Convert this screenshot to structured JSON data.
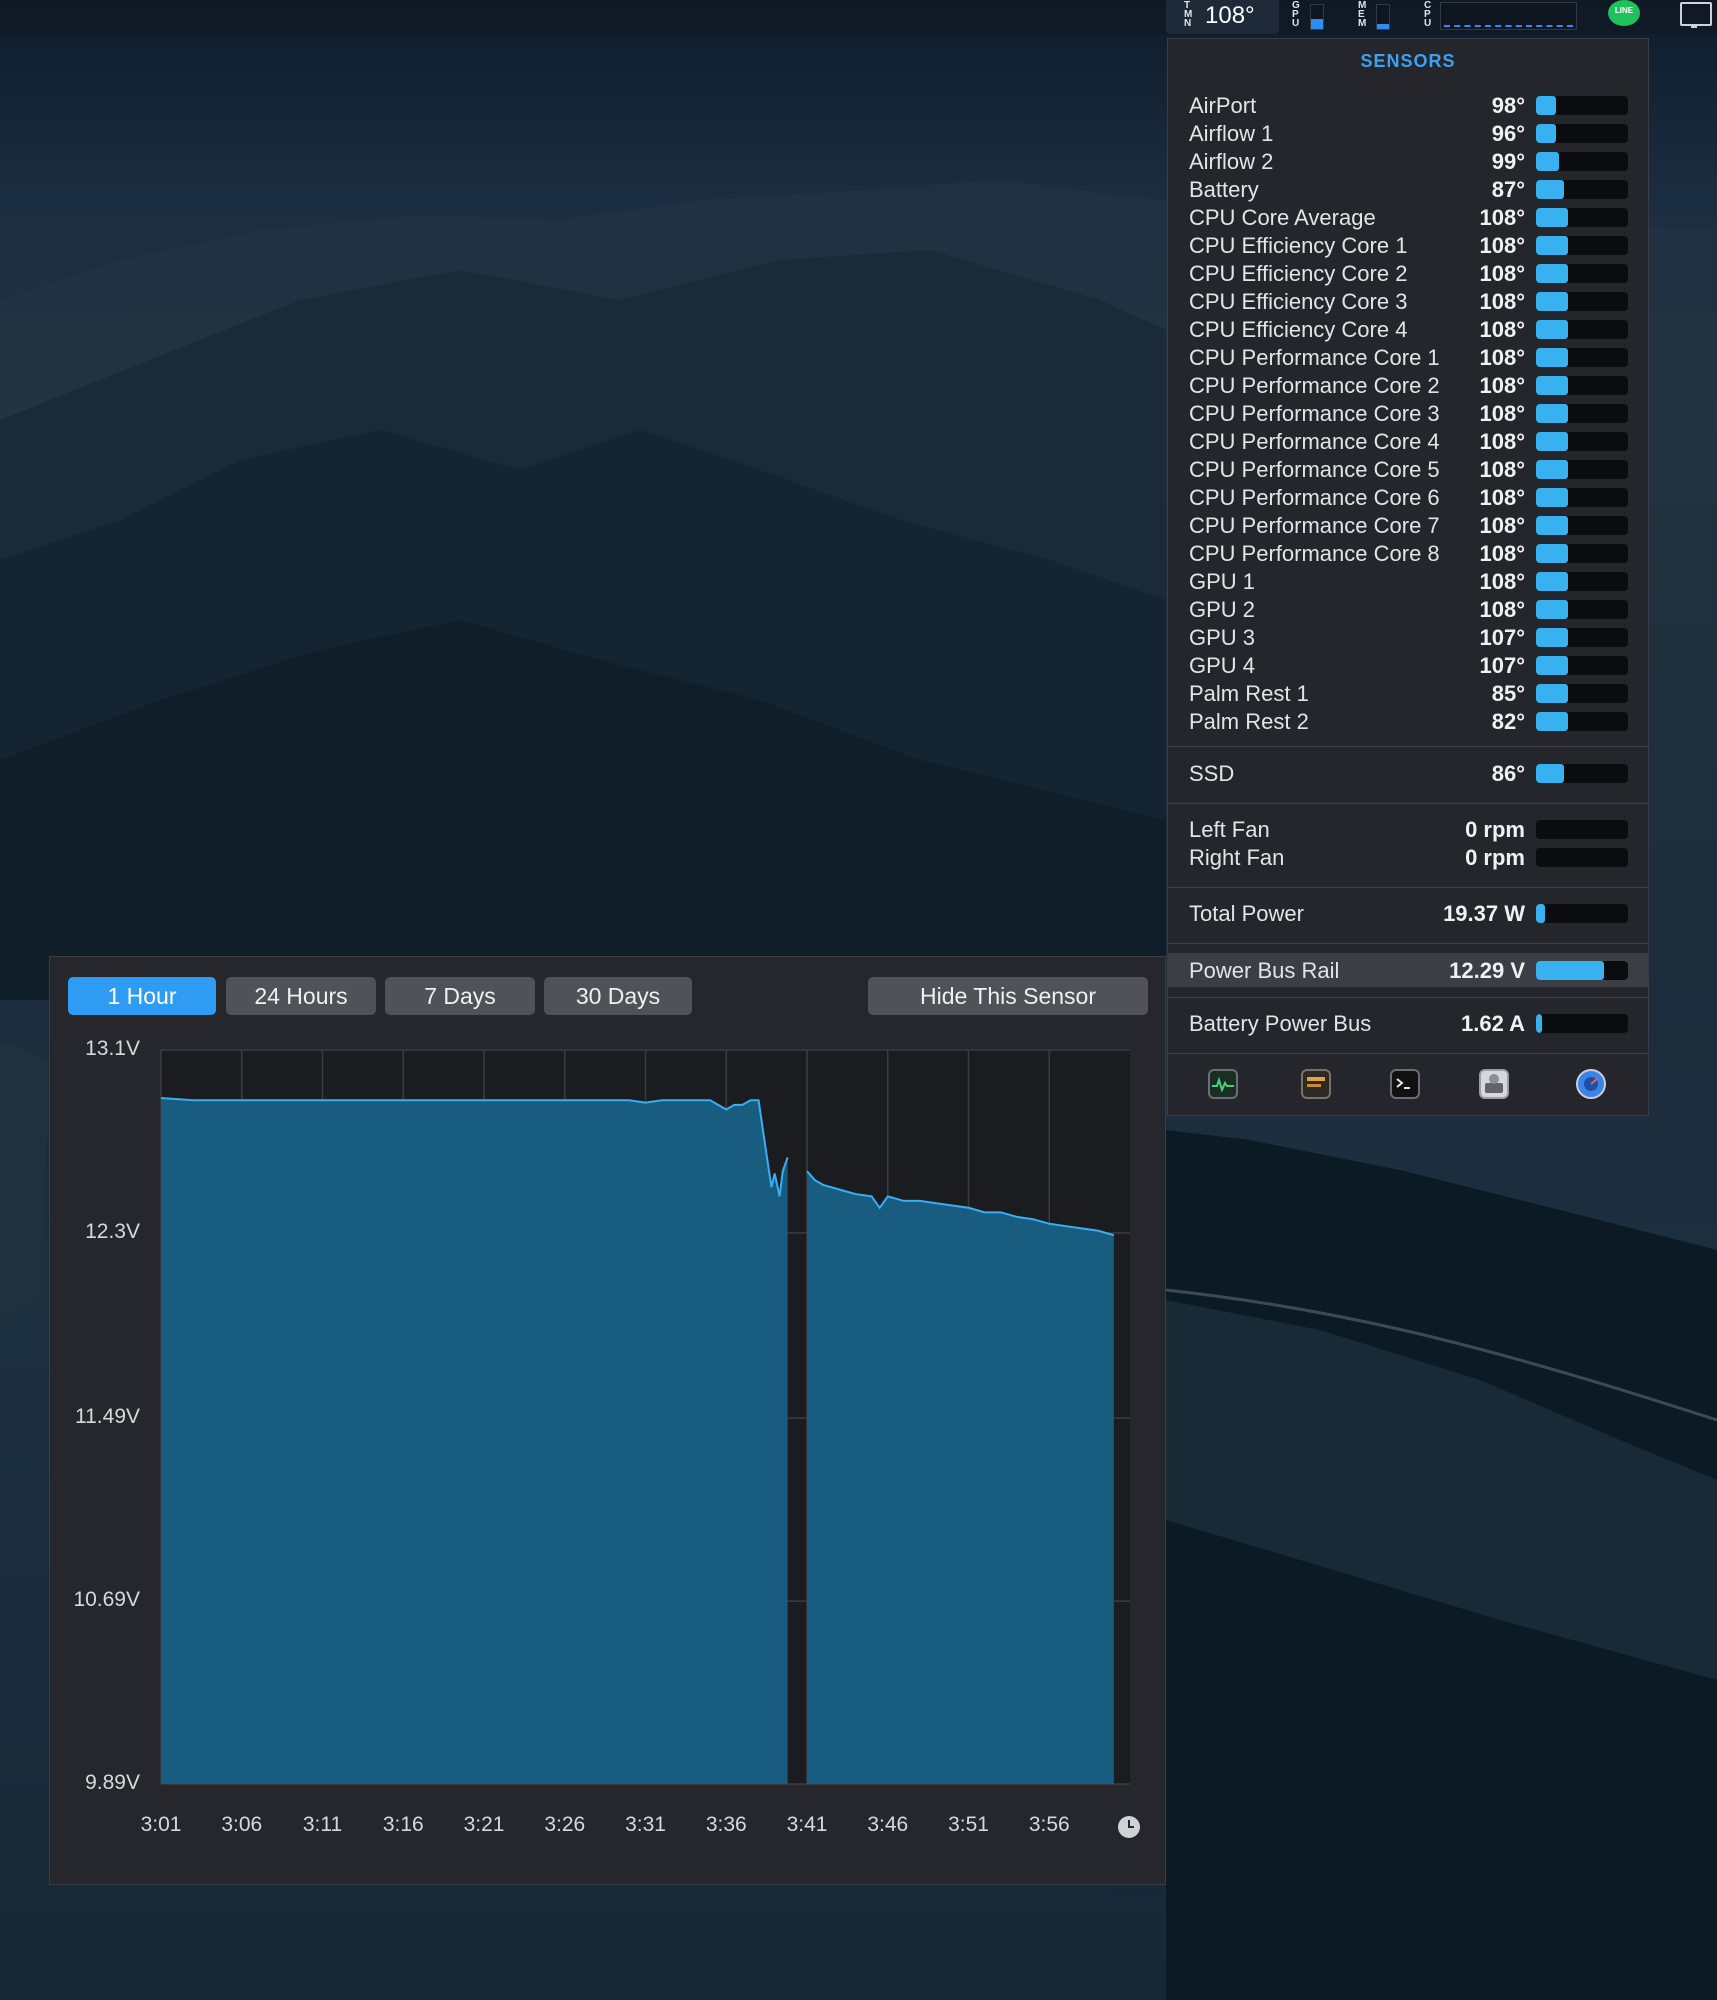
{
  "menubar": {
    "temp_label": "T\nM\nN",
    "temp_value": "108°",
    "gpu_label": "G\nP\nU",
    "mem_label": "M\nE\nM",
    "cpu_label": "C\nP\nU",
    "line_icon_label": "LINE"
  },
  "sensors": {
    "title": "SENSORS",
    "temperatures": [
      {
        "name": "AirPort",
        "value": "98°",
        "level": 0.22
      },
      {
        "name": "Airflow 1",
        "value": "96°",
        "level": 0.22
      },
      {
        "name": "Airflow 2",
        "value": "99°",
        "level": 0.25
      },
      {
        "name": "Battery",
        "value": "87°",
        "level": 0.3
      },
      {
        "name": "CPU Core Average",
        "value": "108°",
        "level": 0.35
      },
      {
        "name": "CPU Efficiency Core 1",
        "value": "108°",
        "level": 0.35
      },
      {
        "name": "CPU Efficiency Core 2",
        "value": "108°",
        "level": 0.35
      },
      {
        "name": "CPU Efficiency Core 3",
        "value": "108°",
        "level": 0.35
      },
      {
        "name": "CPU Efficiency Core 4",
        "value": "108°",
        "level": 0.35
      },
      {
        "name": "CPU Performance Core 1",
        "value": "108°",
        "level": 0.35
      },
      {
        "name": "CPU Performance Core 2",
        "value": "108°",
        "level": 0.35
      },
      {
        "name": "CPU Performance Core 3",
        "value": "108°",
        "level": 0.35
      },
      {
        "name": "CPU Performance Core 4",
        "value": "108°",
        "level": 0.35
      },
      {
        "name": "CPU Performance Core 5",
        "value": "108°",
        "level": 0.35
      },
      {
        "name": "CPU Performance Core 6",
        "value": "108°",
        "level": 0.35
      },
      {
        "name": "CPU Performance Core 7",
        "value": "108°",
        "level": 0.35
      },
      {
        "name": "CPU Performance Core 8",
        "value": "108°",
        "level": 0.35
      },
      {
        "name": "GPU 1",
        "value": "108°",
        "level": 0.35
      },
      {
        "name": "GPU 2",
        "value": "108°",
        "level": 0.35
      },
      {
        "name": "GPU 3",
        "value": "107°",
        "level": 0.35
      },
      {
        "name": "GPU 4",
        "value": "107°",
        "level": 0.35
      },
      {
        "name": "Palm Rest 1",
        "value": "85°",
        "level": 0.35
      },
      {
        "name": "Palm Rest 2",
        "value": "82°",
        "level": 0.35
      }
    ],
    "ssd": {
      "name": "SSD",
      "value": "86°",
      "level": 0.3
    },
    "fans": [
      {
        "name": "Left Fan",
        "value": "0 rpm",
        "level": 0
      },
      {
        "name": "Right Fan",
        "value": "0 rpm",
        "level": 0
      }
    ],
    "power": {
      "name": "Total Power",
      "value": "19.37 W",
      "level": 0.1
    },
    "power_bus_rail": {
      "name": "Power Bus Rail",
      "value": "12.29 V",
      "level": 0.74
    },
    "battery_power_bus": {
      "name": "Battery Power Bus",
      "value": "1.62 A",
      "level": 0.07
    },
    "icons": [
      "activity-monitor-icon",
      "console-icon",
      "terminal-icon",
      "disk-utility-icon",
      "system-information-icon"
    ]
  },
  "chart_panel": {
    "tabs": [
      "1 Hour",
      "24 Hours",
      "7 Days",
      "30 Days"
    ],
    "active_tab": "1 Hour",
    "hide_button": "Hide This Sensor"
  },
  "chart_data": {
    "type": "area",
    "title": "",
    "xlabel": "",
    "ylabel": "",
    "y_tick_labels": [
      "13.1V",
      "12.3V",
      "11.49V",
      "10.69V",
      "9.89V"
    ],
    "y_ticks": [
      13.1,
      12.3,
      11.49,
      10.69,
      9.89
    ],
    "ylim": [
      9.89,
      13.1
    ],
    "x_tick_labels": [
      "3:01",
      "3:06",
      "3:11",
      "3:16",
      "3:21",
      "3:26",
      "3:31",
      "3:36",
      "3:41",
      "3:46",
      "3:51",
      "3:56"
    ],
    "xlim": [
      "3:01",
      "4:01"
    ],
    "fill_color": "#185c80",
    "line_color": "#3aaef0",
    "grid": true,
    "segments": [
      {
        "x": [
          "3:01",
          "3:03",
          "3:06",
          "3:10",
          "3:15",
          "3:20",
          "3:25",
          "3:30",
          "3:31",
          "3:32",
          "3:34",
          "3:35",
          "3:36",
          "3:36.5",
          "3:37",
          "3:37.5",
          "3:38",
          "3:38.5",
          "3:38.8",
          "3:39",
          "3:39.3",
          "3:39.5",
          "3:39.8"
        ],
        "y": [
          12.89,
          12.88,
          12.88,
          12.88,
          12.88,
          12.88,
          12.88,
          12.88,
          12.87,
          12.88,
          12.88,
          12.88,
          12.84,
          12.86,
          12.86,
          12.88,
          12.88,
          12.64,
          12.5,
          12.56,
          12.46,
          12.57,
          12.63
        ]
      },
      {
        "x": [
          "3:41",
          "3:41.5",
          "3:42",
          "3:43",
          "3:44",
          "3:45",
          "3:45.5",
          "3:46",
          "3:47",
          "3:48",
          "3:49",
          "3:50",
          "3:51",
          "3:52",
          "3:53",
          "3:54",
          "3:55",
          "3:56",
          "3:57",
          "3:58",
          "3:59",
          "4:00"
        ],
        "y": [
          12.57,
          12.53,
          12.51,
          12.49,
          12.47,
          12.46,
          12.41,
          12.46,
          12.44,
          12.44,
          12.43,
          12.42,
          12.41,
          12.39,
          12.39,
          12.37,
          12.36,
          12.34,
          12.33,
          12.32,
          12.31,
          12.29
        ]
      }
    ]
  }
}
